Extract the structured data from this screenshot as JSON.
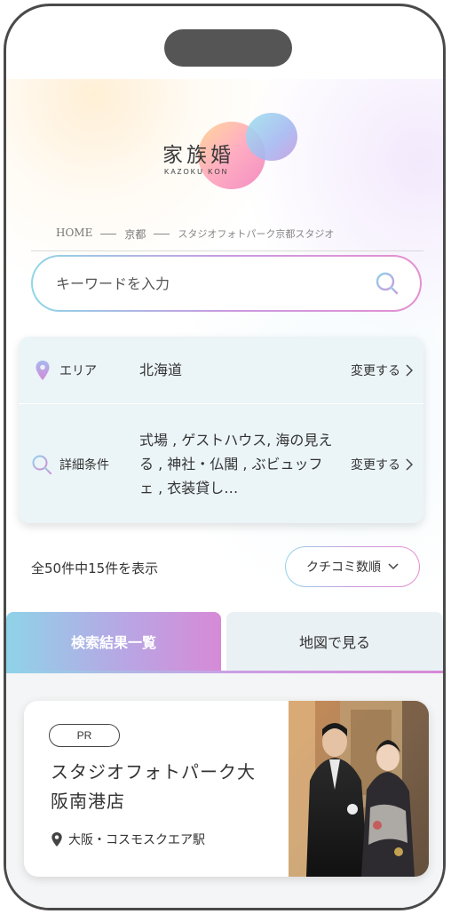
{
  "logo": {
    "text": "家族婚",
    "sub": "KAZOKU KON"
  },
  "breadcrumb": {
    "home": "HOME",
    "city": "京都",
    "current": "スタジオフォトパーク京都スタジオ"
  },
  "search": {
    "placeholder": "キーワードを入力"
  },
  "filters": {
    "area": {
      "label": "エリア",
      "value": "北海道",
      "change": "変更する"
    },
    "detail": {
      "label": "詳細条件",
      "value": "式場 , ゲストハウス, 海の見える , 神社・仏閣 , ぶビュッフェ , 衣装貸し…",
      "change": "変更する"
    }
  },
  "results": {
    "count_text": "全50件中15件を表示",
    "sort_label": "クチコミ数順"
  },
  "tabs": {
    "list": "検索結果一覧",
    "map": "地図で見る"
  },
  "card": {
    "badge": "PR",
    "name": "スタジオフォトパーク大阪南港店",
    "location": "大阪・コスモスクエア駅"
  },
  "colors": {
    "accent_start": "#8fd3e8",
    "accent_end": "#d78ad6",
    "panel": "#eaf1f4",
    "text": "#333333"
  },
  "icons": [
    "map-pin-icon",
    "search-icon",
    "chevron-right-icon",
    "chevron-down-icon"
  ]
}
